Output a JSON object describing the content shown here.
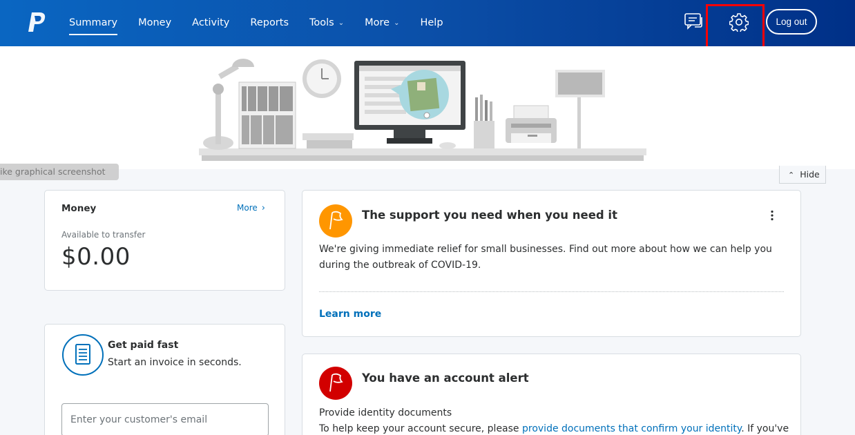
{
  "header": {
    "nav": [
      {
        "label": "Summary",
        "active": true
      },
      {
        "label": "Money"
      },
      {
        "label": "Activity"
      },
      {
        "label": "Reports"
      },
      {
        "label": "Tools",
        "dropdown": true
      },
      {
        "label": "More",
        "dropdown": true
      },
      {
        "label": "Help"
      }
    ],
    "logout_label": "Log out",
    "icons": [
      "paypal-logo-icon",
      "messages-icon",
      "settings-gear-icon"
    ]
  },
  "hero": {
    "overlay_text": "ike graphical screenshot",
    "hide_label": "Hide"
  },
  "money_card": {
    "title": "Money",
    "more_label": "More",
    "subtitle": "Available to transfer",
    "amount": "$0.00"
  },
  "paid_card": {
    "title": "Get paid fast",
    "subtitle": "Start an invoice in seconds.",
    "email_placeholder": "Enter your customer's email"
  },
  "support_card": {
    "title": "The support you need when you need it",
    "body": "We're giving immediate relief for small businesses. Find out more about how we can help you during the outbreak of COVID-19.",
    "link": "Learn more"
  },
  "alert_card": {
    "title": "You have an account alert",
    "line1": "Provide identity documents",
    "line2_prefix": "To help keep your account secure, please ",
    "line2_link": "provide documents that confirm your identity",
    "line2_suffix": ". If you've"
  },
  "colors": {
    "header_start": "#0a66c2",
    "header_end": "#003087",
    "accent_blue": "#0070ba",
    "support_flag": "#ff9600",
    "alert_flag": "#d20000",
    "highlight_box": "#ff0000"
  }
}
